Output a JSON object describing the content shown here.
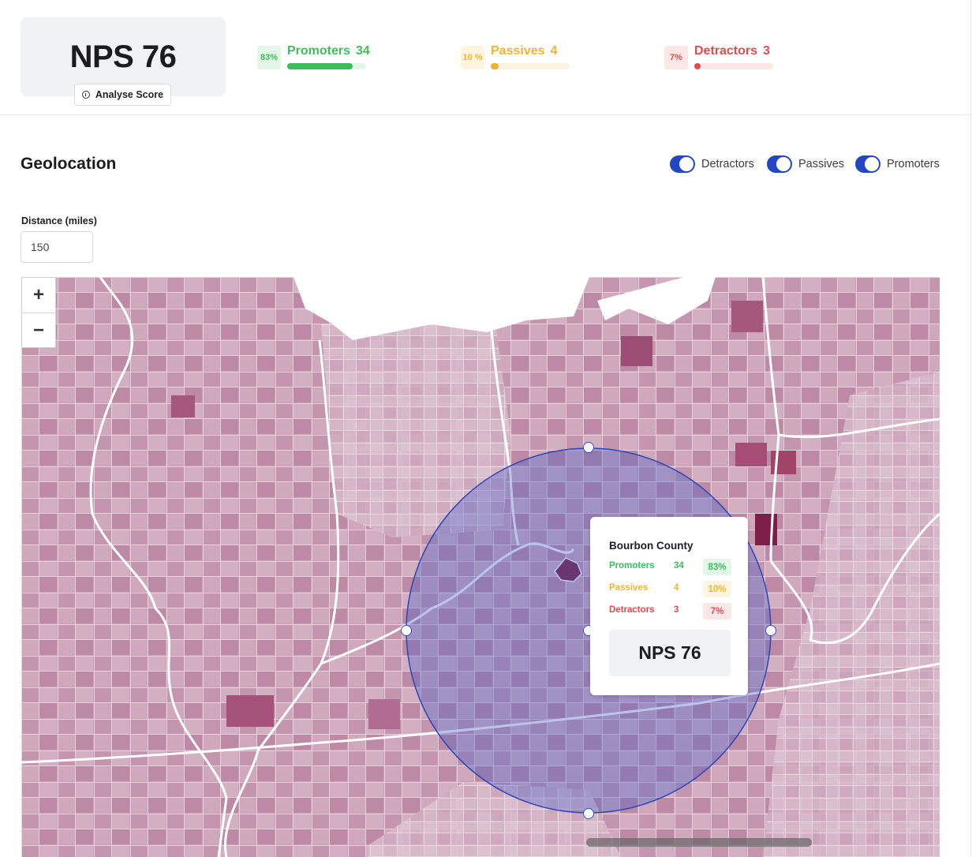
{
  "summary": {
    "nps_title": "NPS 76",
    "analyse_label": "Analyse Score",
    "promoters": {
      "pct": "83%",
      "label": "Promoters",
      "count": "34",
      "fraction": 0.83
    },
    "passives": {
      "pct": "10 %",
      "label": "Passives",
      "count": "4",
      "fraction": 0.1
    },
    "detractors": {
      "pct": "7%",
      "label": "Detractors",
      "count": "3",
      "fraction": 0.07
    }
  },
  "geolocation": {
    "title": "Geolocation",
    "toggles": [
      {
        "label": "Detractors",
        "on": true
      },
      {
        "label": "Passives",
        "on": true
      },
      {
        "label": "Promoters",
        "on": true
      }
    ],
    "distance_label": "Distance (miles)",
    "distance_value": "150"
  },
  "map": {
    "zoom_in": "+",
    "zoom_out": "−",
    "radius_color": "#3a4fb3",
    "tooltip": {
      "county": "Bourbon County",
      "promoters": {
        "label": "Promoters",
        "count": "34",
        "pct": "83%"
      },
      "passives": {
        "label": "Passives",
        "count": "4",
        "pct": "10%"
      },
      "detractors": {
        "label": "Detractors",
        "count": "3",
        "pct": "7%"
      },
      "nps": "NPS 76"
    }
  },
  "colors": {
    "promoters": "#3fbd5d",
    "passives": "#f1b42f",
    "detractors": "#e04b4b",
    "toggle_on": "#2346c3"
  }
}
